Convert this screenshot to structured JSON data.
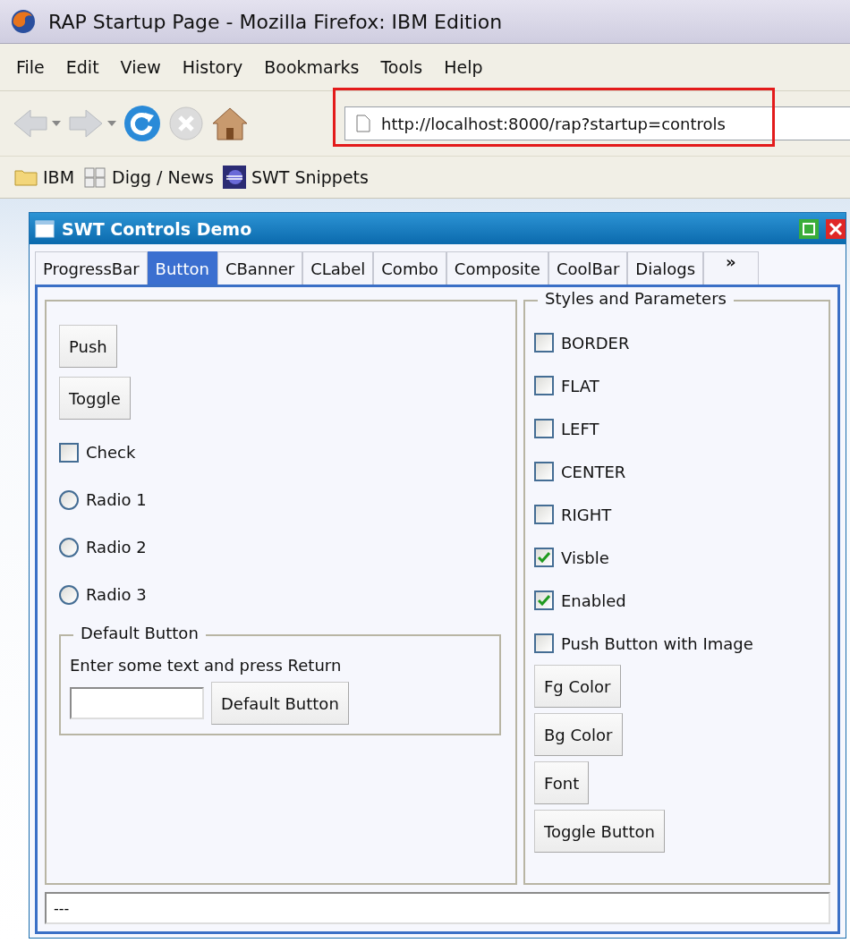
{
  "browser": {
    "title": "RAP Startup Page - Mozilla Firefox: IBM Edition",
    "menu": [
      {
        "label": "File"
      },
      {
        "label": "Edit"
      },
      {
        "label": "View"
      },
      {
        "label": "History"
      },
      {
        "label": "Bookmarks"
      },
      {
        "label": "Tools"
      },
      {
        "label": "Help"
      }
    ],
    "address": {
      "value": "http://localhost:8000/rap?startup=controls",
      "highlighted": true
    },
    "bookmarks": [
      {
        "kind": "folder",
        "label": "IBM"
      },
      {
        "kind": "feed",
        "label": "Digg / News"
      },
      {
        "kind": "site",
        "label": "SWT Snippets"
      }
    ]
  },
  "demo_window": {
    "title": "SWT Controls Demo",
    "tabs": [
      {
        "label": "ProgressBar",
        "selected": false
      },
      {
        "label": "Button",
        "selected": true
      },
      {
        "label": "CBanner",
        "selected": false
      },
      {
        "label": "CLabel",
        "selected": false
      },
      {
        "label": "Combo",
        "selected": false
      },
      {
        "label": "Composite",
        "selected": false
      },
      {
        "label": "CoolBar",
        "selected": false
      },
      {
        "label": "Dialogs",
        "selected": false
      }
    ],
    "more_tabs": "»",
    "controls": [
      {
        "kind": "push",
        "label": "Push"
      },
      {
        "kind": "push",
        "label": "Toggle"
      },
      {
        "kind": "check",
        "label": "Check",
        "checked": false
      },
      {
        "kind": "radio",
        "label": "Radio 1",
        "selected": false
      },
      {
        "kind": "radio",
        "label": "Radio 2",
        "selected": false
      },
      {
        "kind": "radio",
        "label": "Radio 3",
        "selected": false
      }
    ],
    "default_group": {
      "title": "Default Button",
      "hint": "Enter some text and press Return",
      "button": "Default Button"
    },
    "styles": {
      "title": "Styles and Parameters",
      "options": [
        {
          "label": "BORDER",
          "checked": false
        },
        {
          "label": "FLAT",
          "checked": false
        },
        {
          "label": "LEFT",
          "checked": false
        },
        {
          "label": "CENTER",
          "checked": false
        },
        {
          "label": "RIGHT",
          "checked": false
        },
        {
          "label": "Visble",
          "checked": true
        },
        {
          "label": "Enabled",
          "checked": true
        },
        {
          "label": "Push Button with Image",
          "checked": false
        }
      ],
      "buttons": [
        "Fg Color",
        "Bg Color",
        "Font",
        "Toggle Button"
      ]
    },
    "status_field": {
      "value": "---"
    }
  }
}
